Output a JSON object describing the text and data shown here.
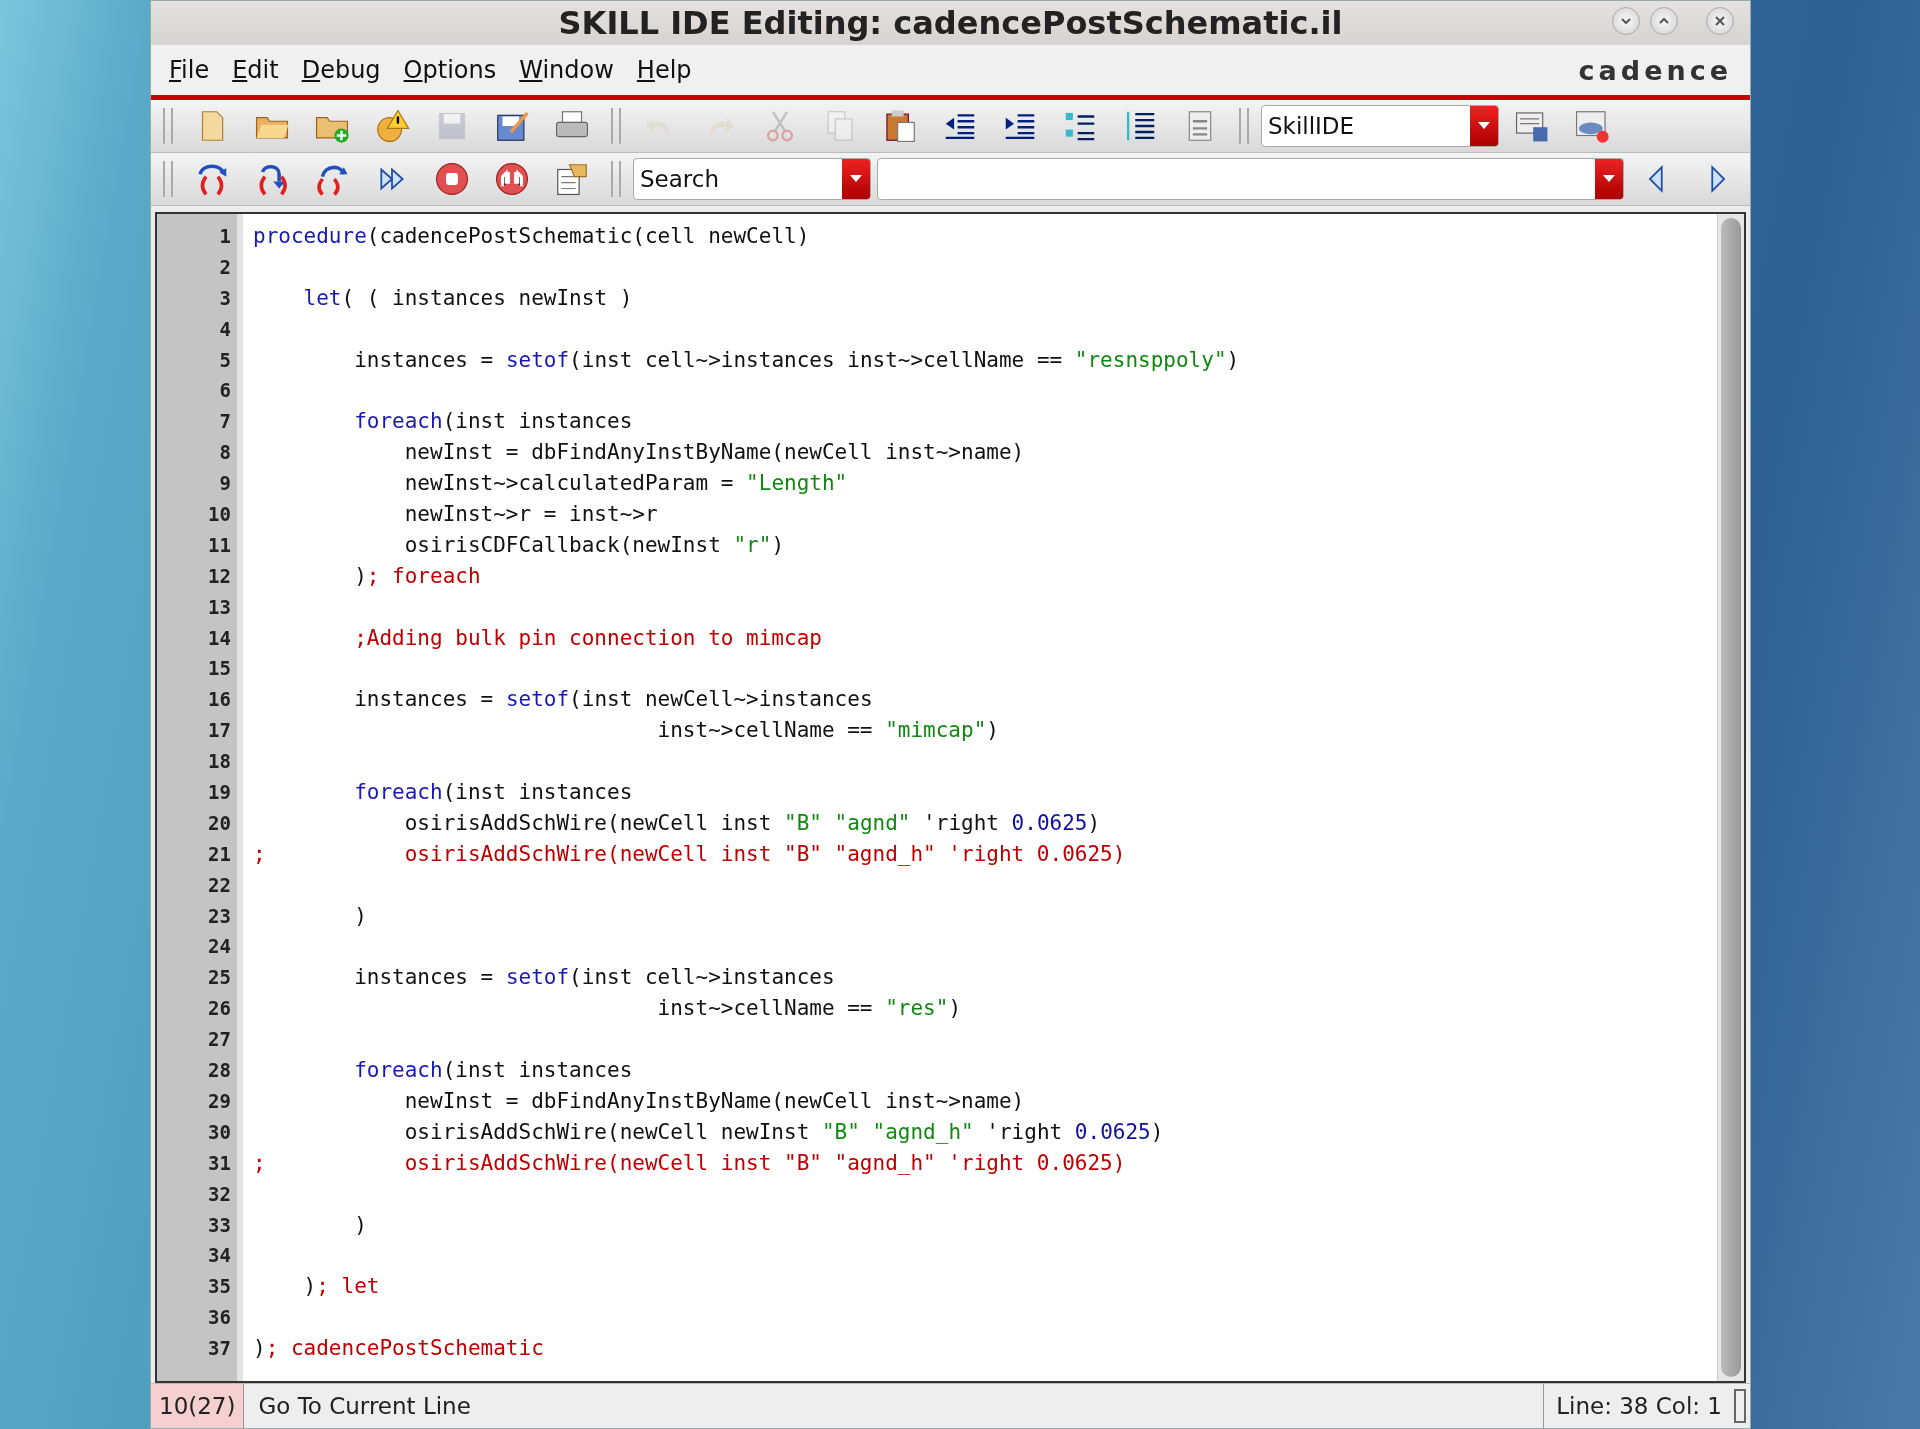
{
  "window": {
    "title": "SKILL IDE Editing: cadencePostSchematic.il"
  },
  "menu": [
    {
      "label": "File"
    },
    {
      "label": "Edit"
    },
    {
      "label": "Debug"
    },
    {
      "label": "Options"
    },
    {
      "label": "Window"
    },
    {
      "label": "Help"
    }
  ],
  "logo": "cadence",
  "toolbar": {
    "mode_combo": "SkillIDE",
    "search_combo": "Search"
  },
  "editor": {
    "lines": [
      {
        "number": "1",
        "segments": [
          {
            "kind": "keyword",
            "text": "procedure"
          },
          {
            "kind": "plain",
            "text": "(cadencePostSchematic(cell newCell)"
          }
        ]
      },
      {
        "number": "2"
      },
      {
        "number": "3",
        "segments": [
          {
            "kind": "keyword",
            "text": "    let"
          },
          {
            "kind": "plain",
            "text": "( ( instances newInst )"
          }
        ]
      },
      {
        "number": "4"
      },
      {
        "number": "5",
        "segments": [
          {
            "kind": "plain",
            "text": "        instances = "
          },
          {
            "kind": "keyword",
            "text": "setof"
          },
          {
            "kind": "plain",
            "text": "(inst cell~>instances inst~>cellName == "
          },
          {
            "kind": "string",
            "text": "\"resnsppoly\""
          },
          {
            "kind": "plain",
            "text": ")"
          }
        ]
      },
      {
        "number": "6"
      },
      {
        "number": "7",
        "segments": [
          {
            "kind": "keyword",
            "text": "        foreach"
          },
          {
            "kind": "plain",
            "text": "(inst instances"
          }
        ]
      },
      {
        "number": "8",
        "segments": [
          {
            "kind": "plain",
            "text": "            newInst = dbFindAnyInstByName(newCell inst~>name)"
          }
        ]
      },
      {
        "number": "9",
        "segments": [
          {
            "kind": "plain",
            "text": "            newInst~>calculatedParam = "
          },
          {
            "kind": "string",
            "text": "\"Length\""
          }
        ]
      },
      {
        "number": "10",
        "segments": [
          {
            "kind": "plain",
            "text": "            newInst~>r = inst~>r"
          }
        ]
      },
      {
        "number": "11",
        "segments": [
          {
            "kind": "plain",
            "text": "            osirisCDFCallback(newInst "
          },
          {
            "kind": "string",
            "text": "\"r\""
          },
          {
            "kind": "plain",
            "text": ")"
          }
        ]
      },
      {
        "number": "12",
        "segments": [
          {
            "kind": "plain",
            "text": "        )"
          },
          {
            "kind": "comment",
            "text": "; foreach"
          }
        ]
      },
      {
        "number": "13"
      },
      {
        "number": "14",
        "segments": [
          {
            "kind": "comment",
            "text": "        ;Adding bulk pin connection to mimcap"
          }
        ]
      },
      {
        "number": "15"
      },
      {
        "number": "16",
        "segments": [
          {
            "kind": "plain",
            "text": "        instances = "
          },
          {
            "kind": "keyword",
            "text": "setof"
          },
          {
            "kind": "plain",
            "text": "(inst newCell~>instances"
          }
        ]
      },
      {
        "number": "17",
        "segments": [
          {
            "kind": "plain",
            "text": "                                inst~>cellName == "
          },
          {
            "kind": "string",
            "text": "\"mimcap\""
          },
          {
            "kind": "plain",
            "text": ")"
          }
        ]
      },
      {
        "number": "18"
      },
      {
        "number": "19",
        "segments": [
          {
            "kind": "keyword",
            "text": "        foreach"
          },
          {
            "kind": "plain",
            "text": "(inst instances"
          }
        ]
      },
      {
        "number": "20",
        "segments": [
          {
            "kind": "plain",
            "text": "            osirisAddSchWire(newCell inst "
          },
          {
            "kind": "string",
            "text": "\"B\" "
          },
          {
            "kind": "string",
            "text": "\"agnd\""
          },
          {
            "kind": "plain",
            "text": " 'right "
          },
          {
            "kind": "number",
            "text": "0.0625"
          },
          {
            "kind": "plain",
            "text": ")"
          }
        ]
      },
      {
        "number": "21",
        "segments": [
          {
            "kind": "comment",
            "text": ";           osirisAddSchWire(newCell inst \"B\" \"agnd_h\" 'right 0.0625)"
          }
        ]
      },
      {
        "number": "22"
      },
      {
        "number": "23",
        "segments": [
          {
            "kind": "plain",
            "text": "        )"
          }
        ]
      },
      {
        "number": "24"
      },
      {
        "number": "25",
        "segments": [
          {
            "kind": "plain",
            "text": "        instances = "
          },
          {
            "kind": "keyword",
            "text": "setof"
          },
          {
            "kind": "plain",
            "text": "(inst cell~>instances"
          }
        ]
      },
      {
        "number": "26",
        "segments": [
          {
            "kind": "plain",
            "text": "                                inst~>cellName == "
          },
          {
            "kind": "string",
            "text": "\"res\""
          },
          {
            "kind": "plain",
            "text": ")"
          }
        ]
      },
      {
        "number": "27"
      },
      {
        "number": "28",
        "segments": [
          {
            "kind": "keyword",
            "text": "        foreach"
          },
          {
            "kind": "plain",
            "text": "(inst instances"
          }
        ]
      },
      {
        "number": "29",
        "segments": [
          {
            "kind": "plain",
            "text": "            newInst = dbFindAnyInstByName(newCell inst~>name)"
          }
        ]
      },
      {
        "number": "30",
        "segments": [
          {
            "kind": "plain",
            "text": "            osirisAddSchWire(newCell newInst "
          },
          {
            "kind": "string",
            "text": "\"B\" "
          },
          {
            "kind": "string",
            "text": "\"agnd_h\""
          },
          {
            "kind": "plain",
            "text": " 'right "
          },
          {
            "kind": "number",
            "text": "0.0625"
          },
          {
            "kind": "plain",
            "text": ")"
          }
        ]
      },
      {
        "number": "31",
        "segments": [
          {
            "kind": "comment",
            "text": ";           osirisAddSchWire(newCell inst \"B\" \"agnd_h\" 'right 0.0625)"
          }
        ]
      },
      {
        "number": "32"
      },
      {
        "number": "33",
        "segments": [
          {
            "kind": "plain",
            "text": "        )"
          }
        ]
      },
      {
        "number": "34"
      },
      {
        "number": "35",
        "segments": [
          {
            "kind": "plain",
            "text": "    )"
          },
          {
            "kind": "comment",
            "text": "; let"
          }
        ]
      },
      {
        "number": "36"
      },
      {
        "number": "37",
        "segments": [
          {
            "kind": "plain",
            "text": ")"
          },
          {
            "kind": "comment",
            "text": "; cadencePostSchematic"
          }
        ]
      }
    ]
  },
  "status_bar": {
    "position": "10(27)",
    "message": "Go To Current Line",
    "cursor": "Line: 38 Col: 1"
  }
}
